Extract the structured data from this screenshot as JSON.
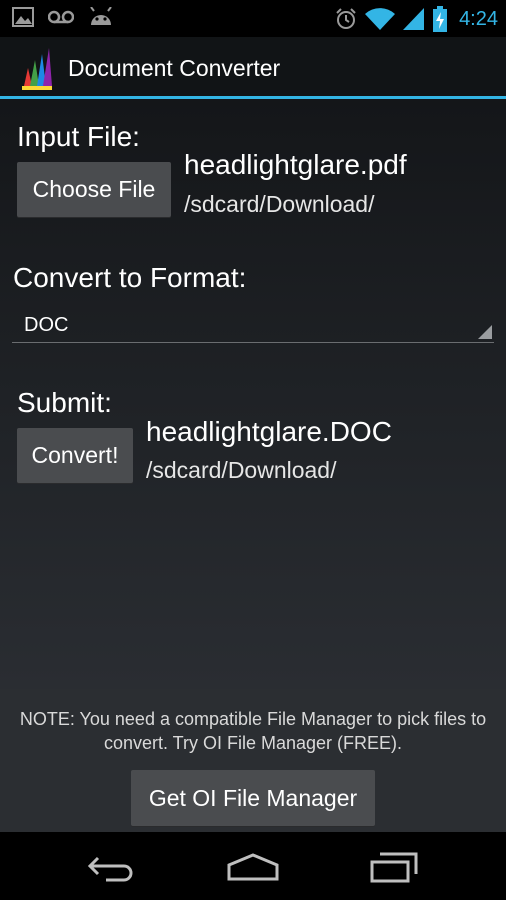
{
  "status": {
    "time": "4:24"
  },
  "app": {
    "title": "Document Converter"
  },
  "input": {
    "label": "Input File:",
    "button": "Choose File",
    "filename": "headlightglare.pdf",
    "path": "/sdcard/Download/"
  },
  "format": {
    "label": "Convert to Format:",
    "selected": "DOC"
  },
  "submit": {
    "label": "Submit:",
    "button": "Convert!",
    "filename": "headlightglare.DOC",
    "path": "/sdcard/Download/"
  },
  "footer": {
    "note": "NOTE: You need a compatible File Manager to pick files to convert. Try OI File Manager (FREE).",
    "button": "Get OI File Manager"
  },
  "colors": {
    "accent": "#33b5e5",
    "button": "#4a4c4f"
  },
  "icons": [
    "picture-icon",
    "voicemail-icon",
    "android-icon",
    "alarm-icon",
    "wifi-icon",
    "signal-icon",
    "battery-charging-icon",
    "back-icon",
    "home-icon",
    "recents-icon"
  ]
}
